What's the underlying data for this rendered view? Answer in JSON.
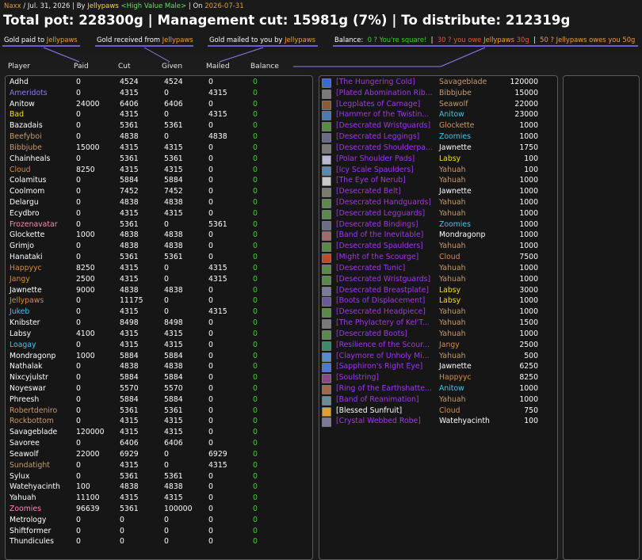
{
  "header": {
    "raid": "Naxx",
    "date": "Jul. 31, 2026",
    "by_label": "By",
    "author": "Jellypaws",
    "guild": "<High Value Male>",
    "on_label": "On",
    "on_date": "2026-07-31",
    "title": "Total pot: 228300g | Management cut: 15981g (7%) | To distribute: 212319g"
  },
  "legend": {
    "paid_label": "Gold paid to",
    "paid_name": "Jellypaws",
    "received_label": "Gold received from",
    "received_name": "Jellypaws",
    "mailed_label": "Gold mailed to you by",
    "mailed_name": "Jellypaws",
    "balance_label": "Balance:",
    "square_text": "0 ? You're square!",
    "owe_text_a": "30 ? you owe",
    "owe_name": "Jellypaws",
    "owe_text_b": "30g",
    "owes_text_a": "50 ? ",
    "owes_name": "Jellypaws",
    "owes_text_b": " owes you 50g"
  },
  "columns": [
    "Player",
    "Paid",
    "Cut",
    "Given",
    "Mailed",
    "Balance"
  ],
  "colors": {
    "white": "#ffffff",
    "purple": "#8a7ff0",
    "yellow": "#f2e01b",
    "orange": "#d98c3c",
    "pink": "#f48cba",
    "blue": "#3fc7eb",
    "tan": "#c69b6d",
    "epic": "#a335ee",
    "green": "#44cc33"
  },
  "players": [
    {
      "name": "Adhd",
      "color": "white",
      "paid": "0",
      "cut": "4524",
      "given": "4524",
      "mailed": "0",
      "balance": "0"
    },
    {
      "name": "Ameridots",
      "color": "purple",
      "paid": "0",
      "cut": "4315",
      "given": "0",
      "mailed": "4315",
      "balance": "0"
    },
    {
      "name": "Anitow",
      "color": "white",
      "paid": "24000",
      "cut": "6406",
      "given": "6406",
      "mailed": "0",
      "balance": "0"
    },
    {
      "name": "Bad",
      "color": "yellow",
      "paid": "0",
      "cut": "4315",
      "given": "0",
      "mailed": "4315",
      "balance": "0"
    },
    {
      "name": "Bazadais",
      "color": "white",
      "paid": "0",
      "cut": "5361",
      "given": "5361",
      "mailed": "0",
      "balance": "0"
    },
    {
      "name": "Beefyboi",
      "color": "tan",
      "paid": "0",
      "cut": "4838",
      "given": "0",
      "mailed": "4838",
      "balance": "0"
    },
    {
      "name": "Bibbjube",
      "color": "tan",
      "paid": "15000",
      "cut": "4315",
      "given": "4315",
      "mailed": "0",
      "balance": "0"
    },
    {
      "name": "Chainheals",
      "color": "white",
      "paid": "0",
      "cut": "5361",
      "given": "5361",
      "mailed": "0",
      "balance": "0"
    },
    {
      "name": "Cloud",
      "color": "orange",
      "paid": "8250",
      "cut": "4315",
      "given": "4315",
      "mailed": "0",
      "balance": "0"
    },
    {
      "name": "Colamitus",
      "color": "white",
      "paid": "0",
      "cut": "5884",
      "given": "5884",
      "mailed": "0",
      "balance": "0"
    },
    {
      "name": "Coolmom",
      "color": "white",
      "paid": "0",
      "cut": "7452",
      "given": "7452",
      "mailed": "0",
      "balance": "0"
    },
    {
      "name": "Delargu",
      "color": "white",
      "paid": "0",
      "cut": "4838",
      "given": "4838",
      "mailed": "0",
      "balance": "0"
    },
    {
      "name": "Ecydbro",
      "color": "white",
      "paid": "0",
      "cut": "4315",
      "given": "4315",
      "mailed": "0",
      "balance": "0"
    },
    {
      "name": "Frozenavatar",
      "color": "pink",
      "paid": "0",
      "cut": "5361",
      "given": "0",
      "mailed": "5361",
      "balance": "0"
    },
    {
      "name": "Glockette",
      "color": "white",
      "paid": "1000",
      "cut": "4838",
      "given": "4838",
      "mailed": "0",
      "balance": "0"
    },
    {
      "name": "Grimjo",
      "color": "white",
      "paid": "0",
      "cut": "4838",
      "given": "4838",
      "mailed": "0",
      "balance": "0"
    },
    {
      "name": "Hanataki",
      "color": "white",
      "paid": "0",
      "cut": "5361",
      "given": "5361",
      "mailed": "0",
      "balance": "0"
    },
    {
      "name": "Happyyc",
      "color": "orange",
      "paid": "8250",
      "cut": "4315",
      "given": "0",
      "mailed": "4315",
      "balance": "0"
    },
    {
      "name": "Jangy",
      "color": "orange",
      "paid": "2500",
      "cut": "4315",
      "given": "0",
      "mailed": "4315",
      "balance": "0"
    },
    {
      "name": "Jawnette",
      "color": "white",
      "paid": "9000",
      "cut": "4838",
      "given": "4838",
      "mailed": "0",
      "balance": "0"
    },
    {
      "name": "Jellypaws",
      "color": "orange",
      "paid": "0",
      "cut": "11175",
      "given": "0",
      "mailed": "0",
      "balance": "0"
    },
    {
      "name": "Jukeb",
      "color": "blue",
      "paid": "0",
      "cut": "4315",
      "given": "0",
      "mailed": "4315",
      "balance": "0"
    },
    {
      "name": "Knibster",
      "color": "white",
      "paid": "0",
      "cut": "8498",
      "given": "8498",
      "mailed": "0",
      "balance": "0"
    },
    {
      "name": "Labsy",
      "color": "white",
      "paid": "4100",
      "cut": "4315",
      "given": "4315",
      "mailed": "0",
      "balance": "0"
    },
    {
      "name": "Loagay",
      "color": "blue",
      "paid": "0",
      "cut": "4315",
      "given": "4315",
      "mailed": "0",
      "balance": "0"
    },
    {
      "name": "Mondragonp",
      "color": "white",
      "paid": "1000",
      "cut": "5884",
      "given": "5884",
      "mailed": "0",
      "balance": "0"
    },
    {
      "name": "Nathalak",
      "color": "white",
      "paid": "0",
      "cut": "4838",
      "given": "4838",
      "mailed": "0",
      "balance": "0"
    },
    {
      "name": "Nixcyjulstr",
      "color": "white",
      "paid": "0",
      "cut": "5884",
      "given": "5884",
      "mailed": "0",
      "balance": "0"
    },
    {
      "name": "Noyeswar",
      "color": "white",
      "paid": "0",
      "cut": "5570",
      "given": "5570",
      "mailed": "0",
      "balance": "0"
    },
    {
      "name": "Phreesh",
      "color": "white",
      "paid": "0",
      "cut": "5884",
      "given": "5884",
      "mailed": "0",
      "balance": "0"
    },
    {
      "name": "Robertdeniro",
      "color": "tan",
      "paid": "0",
      "cut": "5361",
      "given": "5361",
      "mailed": "0",
      "balance": "0"
    },
    {
      "name": "Rockbottom",
      "color": "tan",
      "paid": "0",
      "cut": "4315",
      "given": "4315",
      "mailed": "0",
      "balance": "0"
    },
    {
      "name": "Savageblade",
      "color": "white",
      "paid": "120000",
      "cut": "4315",
      "given": "4315",
      "mailed": "0",
      "balance": "0"
    },
    {
      "name": "Savoree",
      "color": "white",
      "paid": "0",
      "cut": "6406",
      "given": "6406",
      "mailed": "0",
      "balance": "0"
    },
    {
      "name": "Seawolf",
      "color": "white",
      "paid": "22000",
      "cut": "6929",
      "given": "0",
      "mailed": "6929",
      "balance": "0"
    },
    {
      "name": "Sundatight",
      "color": "tan",
      "paid": "0",
      "cut": "4315",
      "given": "0",
      "mailed": "4315",
      "balance": "0"
    },
    {
      "name": "Sylux",
      "color": "white",
      "paid": "0",
      "cut": "5361",
      "given": "5361",
      "mailed": "0",
      "balance": "0"
    },
    {
      "name": "Watehyacinth",
      "color": "white",
      "paid": "100",
      "cut": "4838",
      "given": "4838",
      "mailed": "0",
      "balance": "0"
    },
    {
      "name": "Yahuah",
      "color": "white",
      "paid": "11100",
      "cut": "4315",
      "given": "4315",
      "mailed": "0",
      "balance": "0"
    },
    {
      "name": "Zoomies",
      "color": "pink",
      "paid": "96639",
      "cut": "5361",
      "given": "100000",
      "mailed": "0",
      "balance": "0"
    },
    {
      "name": "Metrology",
      "color": "white",
      "paid": "0",
      "cut": "0",
      "given": "0",
      "mailed": "0",
      "balance": "0"
    },
    {
      "name": "Shiftformer",
      "color": "white",
      "paid": "0",
      "cut": "0",
      "given": "0",
      "mailed": "0",
      "balance": "0"
    },
    {
      "name": "Thundicules",
      "color": "white",
      "paid": "0",
      "cut": "0",
      "given": "0",
      "mailed": "0",
      "balance": "0"
    }
  ],
  "loot": [
    {
      "item": "[The Hungering Cold]",
      "item_color": "epic",
      "icon": "axe-icon",
      "icon_color": "#3a6ad4",
      "buyer": "Savageblade",
      "buyer_color": "tan",
      "price": "120000"
    },
    {
      "item": "[Plated Abomination Rib...",
      "item_color": "epic",
      "icon": "armor-icon",
      "icon_color": "#7a7a7a",
      "buyer": "Bibbjube",
      "buyer_color": "tan",
      "price": "15000"
    },
    {
      "item": "[Legplates of Carnage]",
      "item_color": "epic",
      "icon": "legs-icon",
      "icon_color": "#8a5a3a",
      "buyer": "Seawolf",
      "buyer_color": "tan",
      "price": "22000"
    },
    {
      "item": "[Hammer of the Twistin...",
      "item_color": "epic",
      "icon": "hammer-icon",
      "icon_color": "#4a7ab0",
      "buyer": "Anitow",
      "buyer_color": "blue",
      "price": "23000"
    },
    {
      "item": "[Desecrated Wristguards]",
      "item_color": "epic",
      "icon": "bracers-icon",
      "icon_color": "#5a8a4a",
      "buyer": "Glockette",
      "buyer_color": "tan",
      "price": "1000"
    },
    {
      "item": "[Desecrated Leggings]",
      "item_color": "epic",
      "icon": "legs-icon",
      "icon_color": "#6a6a8a",
      "buyer": "Zoomies",
      "buyer_color": "blue",
      "price": "1000"
    },
    {
      "item": "[Desecrated Shoulderpa...",
      "item_color": "epic",
      "icon": "shoulder-icon",
      "icon_color": "#7a7a7a",
      "buyer": "Jawnette",
      "buyer_color": "white",
      "price": "1750"
    },
    {
      "item": "[Polar Shoulder Pads]",
      "item_color": "epic",
      "icon": "shoulder-icon",
      "icon_color": "#b8b8d0",
      "buyer": "Labsy",
      "buyer_color": "yellow",
      "price": "100"
    },
    {
      "item": "[Icy Scale Spaulders]",
      "item_color": "epic",
      "icon": "shoulder-icon",
      "icon_color": "#5a8ab0",
      "buyer": "Yahuah",
      "buyer_color": "tan",
      "price": "100"
    },
    {
      "item": "[The Eye of Nerub]",
      "item_color": "epic",
      "icon": "polearm-icon",
      "icon_color": "#c8c8c8",
      "buyer": "Yahuah",
      "buyer_color": "tan",
      "price": "1000"
    },
    {
      "item": "[Desecrated Belt]",
      "item_color": "epic",
      "icon": "belt-icon",
      "icon_color": "#7a7a6a",
      "buyer": "Jawnette",
      "buyer_color": "white",
      "price": "1000"
    },
    {
      "item": "[Desecrated Handguards]",
      "item_color": "epic",
      "icon": "gloves-icon",
      "icon_color": "#5a8a4a",
      "buyer": "Yahuah",
      "buyer_color": "tan",
      "price": "1000"
    },
    {
      "item": "[Desecrated Legguards]",
      "item_color": "epic",
      "icon": "legs-icon",
      "icon_color": "#5a8a4a",
      "buyer": "Yahuah",
      "buyer_color": "tan",
      "price": "1000"
    },
    {
      "item": "[Desecrated Bindings]",
      "item_color": "epic",
      "icon": "bracers-icon",
      "icon_color": "#6a6a8a",
      "buyer": "Zoomies",
      "buyer_color": "blue",
      "price": "1000"
    },
    {
      "item": "[Band of the Inevitable]",
      "item_color": "epic",
      "icon": "ring-icon",
      "icon_color": "#a06a6a",
      "buyer": "Mondragonp",
      "buyer_color": "white",
      "price": "1000"
    },
    {
      "item": "[Desecrated Spaulders]",
      "item_color": "epic",
      "icon": "shoulder-icon",
      "icon_color": "#5a8a4a",
      "buyer": "Yahuah",
      "buyer_color": "tan",
      "price": "1000"
    },
    {
      "item": "[Might of the Scourge]",
      "item_color": "epic",
      "icon": "shoulder-icon",
      "icon_color": "#c04a2a",
      "buyer": "Cloud",
      "buyer_color": "orange",
      "price": "7500"
    },
    {
      "item": "[Desecrated Tunic]",
      "item_color": "epic",
      "icon": "chest-icon",
      "icon_color": "#5a8a4a",
      "buyer": "Yahuah",
      "buyer_color": "tan",
      "price": "1000"
    },
    {
      "item": "[Desecrated Wristguards]",
      "item_color": "epic",
      "icon": "bracers-icon",
      "icon_color": "#5a8a4a",
      "buyer": "Yahuah",
      "buyer_color": "tan",
      "price": "1000"
    },
    {
      "item": "[Desecrated Breastplate]",
      "item_color": "epic",
      "icon": "chest-icon",
      "icon_color": "#7a7a9a",
      "buyer": "Labsy",
      "buyer_color": "yellow",
      "price": "3000"
    },
    {
      "item": "[Boots of Displacement]",
      "item_color": "epic",
      "icon": "boots-icon",
      "icon_color": "#6a5a9a",
      "buyer": "Labsy",
      "buyer_color": "yellow",
      "price": "1000"
    },
    {
      "item": "[Desecrated Headpiece]",
      "item_color": "epic",
      "icon": "helm-icon",
      "icon_color": "#5a8a4a",
      "buyer": "Yahuah",
      "buyer_color": "tan",
      "price": "1000"
    },
    {
      "item": "[The Phylactery of Kel'T...",
      "item_color": "epic",
      "icon": "trinket-icon",
      "icon_color": "#7a7a7a",
      "buyer": "Yahuah",
      "buyer_color": "tan",
      "price": "1500"
    },
    {
      "item": "[Desecrated Boots]",
      "item_color": "epic",
      "icon": "boots-icon",
      "icon_color": "#5a8a4a",
      "buyer": "Yahuah",
      "buyer_color": "tan",
      "price": "1000"
    },
    {
      "item": "[Resilience of the Scour...",
      "item_color": "epic",
      "icon": "shoulder-icon",
      "icon_color": "#3a8a6a",
      "buyer": "Jangy",
      "buyer_color": "orange",
      "price": "2500"
    },
    {
      "item": "[Claymore of Unholy Mi...",
      "item_color": "epic",
      "icon": "sword-icon",
      "icon_color": "#5a8ad0",
      "buyer": "Yahuah",
      "buyer_color": "tan",
      "price": "500"
    },
    {
      "item": "[Sapphiron's Right Eye]",
      "item_color": "epic",
      "icon": "eye-icon",
      "icon_color": "#4a7ad4",
      "buyer": "Jawnette",
      "buyer_color": "white",
      "price": "6250"
    },
    {
      "item": "[Soulstring]",
      "item_color": "epic",
      "icon": "bow-icon",
      "icon_color": "#8a4a8a",
      "buyer": "Happyyc",
      "buyer_color": "orange",
      "price": "8250"
    },
    {
      "item": "[Ring of the Earthshatte...",
      "item_color": "epic",
      "icon": "ring-icon",
      "icon_color": "#a06a4a",
      "buyer": "Anitow",
      "buyer_color": "blue",
      "price": "1000"
    },
    {
      "item": "[Band of Reanimation]",
      "item_color": "epic",
      "icon": "ring-icon",
      "icon_color": "#6a8a9a",
      "buyer": "Yahuah",
      "buyer_color": "tan",
      "price": "1000"
    },
    {
      "item": "[Blessed Sunfruit]",
      "item_color": "white",
      "icon": "fruit-icon",
      "icon_color": "#e0a030",
      "buyer": "Cloud",
      "buyer_color": "orange",
      "price": "750"
    },
    {
      "item": "[Crystal Webbed Robe]",
      "item_color": "epic",
      "icon": "robe-icon",
      "icon_color": "#7a7a9a",
      "buyer": "Watehyacinth",
      "buyer_color": "white",
      "price": "100"
    }
  ]
}
